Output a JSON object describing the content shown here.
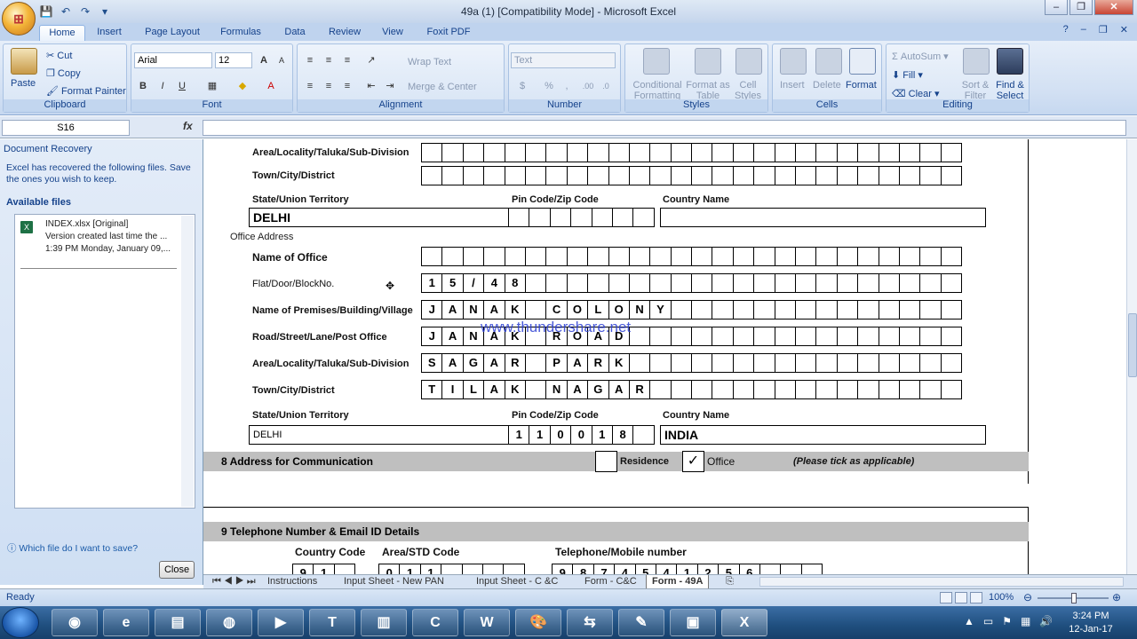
{
  "window": {
    "title": "49a (1)  [Compatibility Mode] - Microsoft Excel",
    "minimize": "–",
    "restore": "❐",
    "close": "✕"
  },
  "qat": {
    "save": "💾",
    "undo": "↶",
    "redo": "↷",
    "more": "▾"
  },
  "tabs": [
    "Home",
    "Insert",
    "Page Layout",
    "Formulas",
    "Data",
    "Review",
    "View",
    "Foxit PDF"
  ],
  "ribbon": {
    "clipboard": {
      "label": "Clipboard",
      "paste": "Paste",
      "cut": "Cut",
      "copy": "Copy",
      "format_painter": "Format Painter"
    },
    "font": {
      "label": "Font",
      "family": "Arial",
      "size": "12",
      "bold": "B",
      "italic": "I",
      "underline": "U",
      "grow": "A",
      "shrink": "A"
    },
    "alignment": {
      "label": "Alignment",
      "wrap": "Wrap Text",
      "merge": "Merge & Center"
    },
    "number": {
      "label": "Number",
      "format": "Text",
      "currency": "$",
      "percent": "%",
      "comma": ","
    },
    "styles": {
      "label": "Styles",
      "conditional": "Conditional Formatting",
      "format_table": "Format as Table",
      "cell_styles": "Cell Styles"
    },
    "cells": {
      "label": "Cells",
      "insert": "Insert",
      "delete": "Delete",
      "format": "Format"
    },
    "editing": {
      "label": "Editing",
      "autosum": "AutoSum",
      "fill": "Fill",
      "clear": "Clear",
      "sort": "Sort & Filter",
      "find": "Find & Select"
    }
  },
  "formula_bar": {
    "name_box": "S16",
    "fx": "fx",
    "value": ""
  },
  "recovery": {
    "title": "Document Recovery",
    "message": "Excel has recovered the following files.  Save the ones you wish to keep.",
    "available": "Available files",
    "file_name": "INDEX.xlsx  [Original]",
    "file_desc": "Version created last time the ...",
    "file_time": "1:39 PM Monday, January 09,...",
    "help_link": "Which file do I want to save?",
    "close": "Close"
  },
  "form": {
    "res_area_label": "Area/Locality/Taluka/Sub-Division",
    "res_town_label": "Town/City/District",
    "res_state_label": "State/Union Territory",
    "res_pin_label": "Pin Code/Zip Code",
    "res_country_label": "Country Name",
    "res_state": "DELHI",
    "office_address": "Office Address",
    "name_office_label": "Name of Office",
    "flat_label": "Flat/Door/BlockNo.",
    "flat_chars": [
      "1",
      "5",
      "/",
      "4",
      "8"
    ],
    "premises_label": "Name of Premises/Building/Village",
    "premises_chars": [
      "J",
      "A",
      "N",
      "A",
      "K",
      "",
      "C",
      "O",
      "L",
      "O",
      "N",
      "Y"
    ],
    "road_label": "Road/Street/Lane/Post Office",
    "road_chars": [
      "J",
      "A",
      "N",
      "A",
      "K",
      "",
      "R",
      "O",
      "A",
      "D"
    ],
    "area_label": "Area/Locality/Taluka/Sub-Division",
    "area_chars": [
      "S",
      "A",
      "G",
      "A",
      "R",
      "",
      "P",
      "A",
      "R",
      "K"
    ],
    "town_label": "Town/City/District",
    "town_chars": [
      "T",
      "I",
      "L",
      "A",
      "K",
      "",
      "N",
      "A",
      "G",
      "A",
      "R"
    ],
    "state_label": "State/Union Territory",
    "pin_label": "Pin Code/Zip Code",
    "country_label": "Country Name",
    "state": "DELHI",
    "pin_chars": [
      "1",
      "1",
      "0",
      "0",
      "1",
      "8"
    ],
    "country": "INDIA",
    "sec8": "8  Address for Communication",
    "residence": "Residence",
    "office": "Office",
    "office_tick": "✓",
    "tick_note": "(Please tick as applicable)",
    "sec9": "9  Telephone Number & Email ID Details",
    "cc_label": "Country Code",
    "std_label": "Area/STD Code",
    "tel_label": "Telephone/Mobile number",
    "cc_chars": [
      "9",
      "1"
    ],
    "std_chars": [
      "0",
      "1",
      "1"
    ],
    "tel_chars": [
      "9",
      "8",
      "7",
      "4",
      "5",
      "4",
      "1",
      "2",
      "5",
      "6"
    ],
    "watermark": "www.thundershare.net"
  },
  "sheet_tabs": [
    "Instructions",
    "Input Sheet - New PAN",
    "Input Sheet - C &C",
    "Form - C&C",
    "Form - 49A"
  ],
  "status": {
    "ready": "Ready",
    "zoom": "100%"
  },
  "clock": {
    "time": "3:24 PM",
    "date": "12-Jan-17"
  }
}
